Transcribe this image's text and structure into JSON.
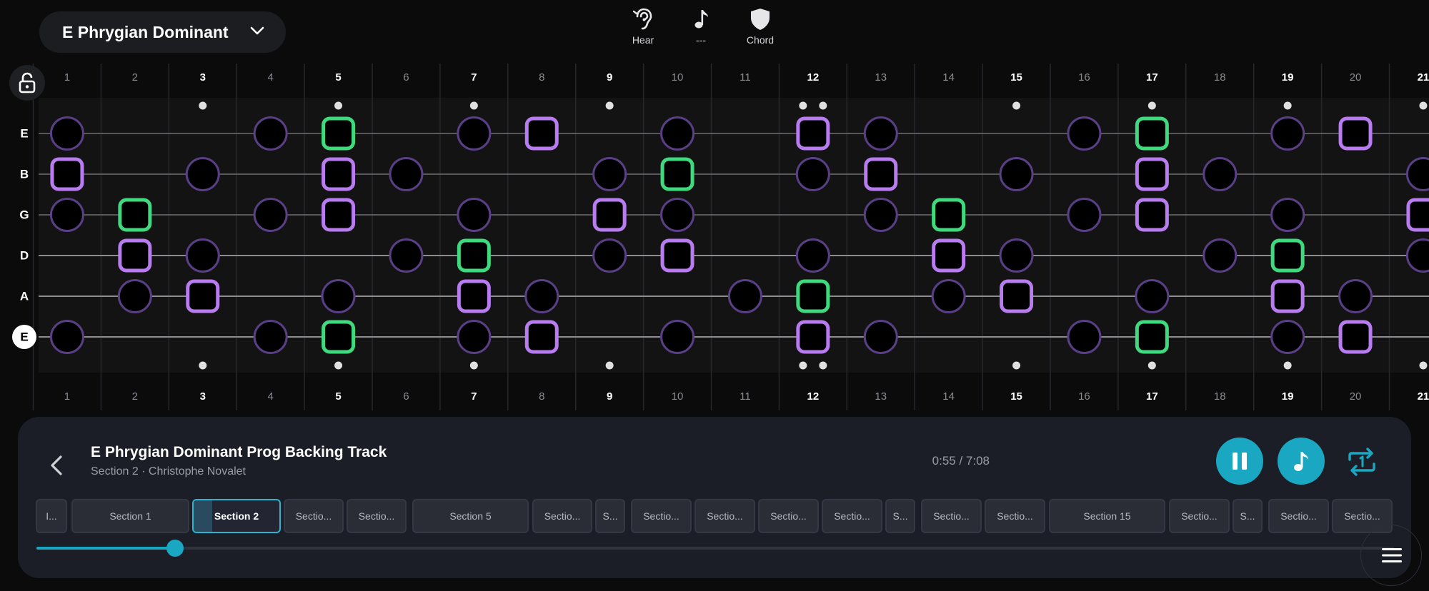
{
  "scale_selector": {
    "label": "E Phrygian Dominant"
  },
  "top_buttons": [
    {
      "id": "hear",
      "icon": "ear-icon",
      "label": "Hear"
    },
    {
      "id": "note",
      "icon": "music-note-icon",
      "label": "---"
    },
    {
      "id": "chord",
      "icon": "shield-icon",
      "label": "Chord"
    }
  ],
  "lock": {
    "icon": "lock-open-icon"
  },
  "fretboard": {
    "strings": [
      "E",
      "B",
      "G",
      "D",
      "A",
      "E"
    ],
    "root_string_index": 5,
    "frets": [
      "1",
      "2",
      "3",
      "4",
      "5",
      "6",
      "7",
      "8",
      "9",
      "10",
      "11",
      "12",
      "13",
      "14",
      "15",
      "16",
      "17",
      "18",
      "19",
      "20",
      "21"
    ],
    "bold_frets": [
      "3",
      "5",
      "7",
      "9",
      "12",
      "15",
      "17",
      "19",
      "21"
    ],
    "markers": {
      "single": [
        3,
        5,
        7,
        9,
        15,
        17,
        19,
        21
      ],
      "double": [
        12
      ]
    },
    "colors": {
      "root": "#3fd97e",
      "chord_tone": "#b87bf0",
      "scale_tone": "#5a3e86",
      "inlay": "#e0e0e0"
    },
    "notes": {
      "root": [
        [
          0,
          5
        ],
        [
          0,
          17
        ],
        [
          1,
          10
        ],
        [
          2,
          2
        ],
        [
          2,
          14
        ],
        [
          3,
          7
        ],
        [
          3,
          19
        ],
        [
          4,
          12
        ],
        [
          5,
          5
        ],
        [
          5,
          17
        ]
      ],
      "chord": [
        [
          0,
          8
        ],
        [
          0,
          12
        ],
        [
          0,
          20
        ],
        [
          1,
          1
        ],
        [
          1,
          5
        ],
        [
          1,
          13
        ],
        [
          1,
          17
        ],
        [
          2,
          5
        ],
        [
          2,
          9
        ],
        [
          2,
          17
        ],
        [
          2,
          21
        ],
        [
          3,
          2
        ],
        [
          3,
          10
        ],
        [
          3,
          14
        ],
        [
          4,
          3
        ],
        [
          4,
          7
        ],
        [
          4,
          15
        ],
        [
          4,
          19
        ],
        [
          5,
          8
        ],
        [
          5,
          12
        ],
        [
          5,
          20
        ]
      ],
      "scale": [
        [
          0,
          1
        ],
        [
          0,
          4
        ],
        [
          0,
          7
        ],
        [
          0,
          10
        ],
        [
          0,
          13
        ],
        [
          0,
          16
        ],
        [
          0,
          19
        ],
        [
          1,
          3
        ],
        [
          1,
          6
        ],
        [
          1,
          9
        ],
        [
          1,
          12
        ],
        [
          1,
          15
        ],
        [
          1,
          18
        ],
        [
          1,
          21
        ],
        [
          2,
          1
        ],
        [
          2,
          4
        ],
        [
          2,
          7
        ],
        [
          2,
          10
        ],
        [
          2,
          13
        ],
        [
          2,
          16
        ],
        [
          2,
          19
        ],
        [
          3,
          3
        ],
        [
          3,
          6
        ],
        [
          3,
          9
        ],
        [
          3,
          12
        ],
        [
          3,
          15
        ],
        [
          3,
          18
        ],
        [
          3,
          21
        ],
        [
          4,
          2
        ],
        [
          4,
          5
        ],
        [
          4,
          8
        ],
        [
          4,
          11
        ],
        [
          4,
          14
        ],
        [
          4,
          17
        ],
        [
          4,
          20
        ],
        [
          5,
          1
        ],
        [
          5,
          4
        ],
        [
          5,
          7
        ],
        [
          5,
          10
        ],
        [
          5,
          13
        ],
        [
          5,
          16
        ],
        [
          5,
          19
        ]
      ]
    }
  },
  "player": {
    "title": "E Phrygian Dominant Prog Backing Track",
    "subtitle": "Section 2 · Christophe Novalet",
    "time": "0:55 / 7:08",
    "progress": 0.102,
    "sections": [
      {
        "label": "I..."
      },
      {
        "label": "Section 1"
      },
      {
        "label": "Section 2",
        "active": true
      },
      {
        "label": "Sectio..."
      },
      {
        "label": "Sectio..."
      },
      {
        "label": "Section 5"
      },
      {
        "label": "Sectio..."
      },
      {
        "label": "S..."
      },
      {
        "label": "Sectio..."
      },
      {
        "label": "Sectio..."
      },
      {
        "label": "Sectio..."
      },
      {
        "label": "Sectio..."
      },
      {
        "label": "S..."
      },
      {
        "label": "Sectio..."
      },
      {
        "label": "Sectio..."
      },
      {
        "label": "Section 15"
      },
      {
        "label": "Sectio..."
      },
      {
        "label": "S..."
      },
      {
        "label": "Sectio..."
      },
      {
        "label": "Sectio..."
      }
    ],
    "accent_color": "#1aa7c2"
  }
}
